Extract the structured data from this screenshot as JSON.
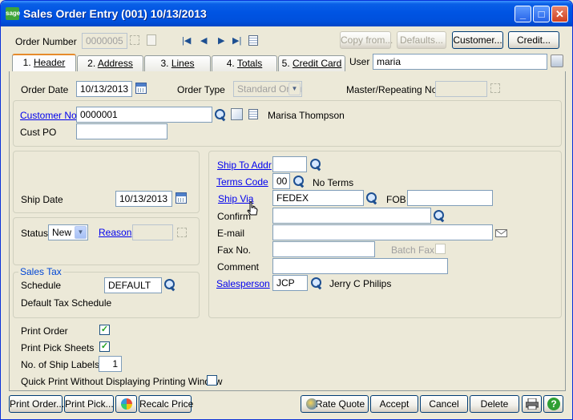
{
  "window": {
    "title": "Sales Order Entry (001) 10/13/2013",
    "app_icon": "sage"
  },
  "header": {
    "order_number_label": "Order Number",
    "order_number_value": "0000005",
    "copy_from_label": "Copy from...",
    "defaults_label": "Defaults...",
    "customer_label": "Customer...",
    "credit_label": "Credit...",
    "user_label": "User",
    "user_value": "maria"
  },
  "tabs": [
    {
      "num": "1.",
      "label": "Header"
    },
    {
      "num": "2.",
      "label": "Address"
    },
    {
      "num": "3.",
      "label": "Lines"
    },
    {
      "num": "4.",
      "label": "Totals"
    },
    {
      "num": "5.",
      "label": "Credit Card"
    }
  ],
  "top_section": {
    "order_date_label": "Order Date",
    "order_date_value": "10/13/2013",
    "order_type_label": "Order Type",
    "order_type_value": "Standard Order",
    "master_label": "Master/Repeating No.",
    "customer_no_label": "Customer No.",
    "customer_no_value": "0000001",
    "customer_name": "Marisa Thompson",
    "cust_po_label": "Cust PO",
    "cust_po_value": ""
  },
  "left_section": {
    "ship_date_label": "Ship Date",
    "ship_date_value": "10/13/2013",
    "status_label": "Status",
    "status_value": "New",
    "reason_label": "Reason",
    "sales_tax_legend": "Sales Tax",
    "schedule_label": "Schedule",
    "schedule_value": "DEFAULT",
    "schedule_desc": "Default Tax Schedule"
  },
  "right_section": {
    "ship_to_label": "Ship To Addr",
    "ship_to_value": "",
    "terms_label": "Terms Code",
    "terms_value": "00",
    "terms_desc": "No Terms",
    "ship_via_label": "Ship Via",
    "ship_via_value": "FEDEX",
    "fob_label": "FOB",
    "fob_value": "",
    "confirm_label": "Confirm",
    "email_label": "E-mail",
    "fax_label": "Fax No.",
    "batch_fax_label": "Batch Fax",
    "comment_label": "Comment",
    "salesperson_label": "Salesperson",
    "salesperson_value": "JCP",
    "salesperson_name": "Jerry C Philips"
  },
  "print_section": {
    "print_order_label": "Print Order",
    "print_order_checked": true,
    "print_pick_label": "Print Pick Sheets",
    "print_pick_checked": true,
    "ship_labels_label": "No. of Ship Labels",
    "ship_labels_value": "1",
    "quick_print_label": "Quick Print Without Displaying Printing Window",
    "quick_print_checked": false
  },
  "footer": {
    "print_order_btn": "Print Order...",
    "print_pick_btn": "Print Pick...",
    "recalc_btn": "Recalc Price",
    "rate_quote_btn": "Rate Quote",
    "accept_btn": "Accept",
    "cancel_btn": "Cancel",
    "delete_btn": "Delete"
  },
  "colors": {
    "title_bar": "#0054e3",
    "link": "#0000ee",
    "window_bg": "#ece9d8",
    "check": "#21a121"
  }
}
